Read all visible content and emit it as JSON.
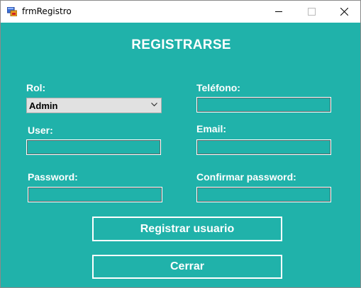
{
  "window": {
    "title": "frmRegistro"
  },
  "form": {
    "heading": "REGISTRARSE",
    "rol": {
      "label": "Rol:",
      "selected": "Admin"
    },
    "user": {
      "label": "User:",
      "value": ""
    },
    "password": {
      "label": "Password:",
      "value": ""
    },
    "telefono": {
      "label": "Teléfono:",
      "value": ""
    },
    "email": {
      "label": "Email:",
      "value": ""
    },
    "confirm": {
      "label": "Confirmar password:",
      "value": ""
    }
  },
  "buttons": {
    "register_label": "Registrar usuario",
    "close_label": "Cerrar"
  },
  "colors": {
    "background": "#20b2aa",
    "text": "#ffffff"
  }
}
